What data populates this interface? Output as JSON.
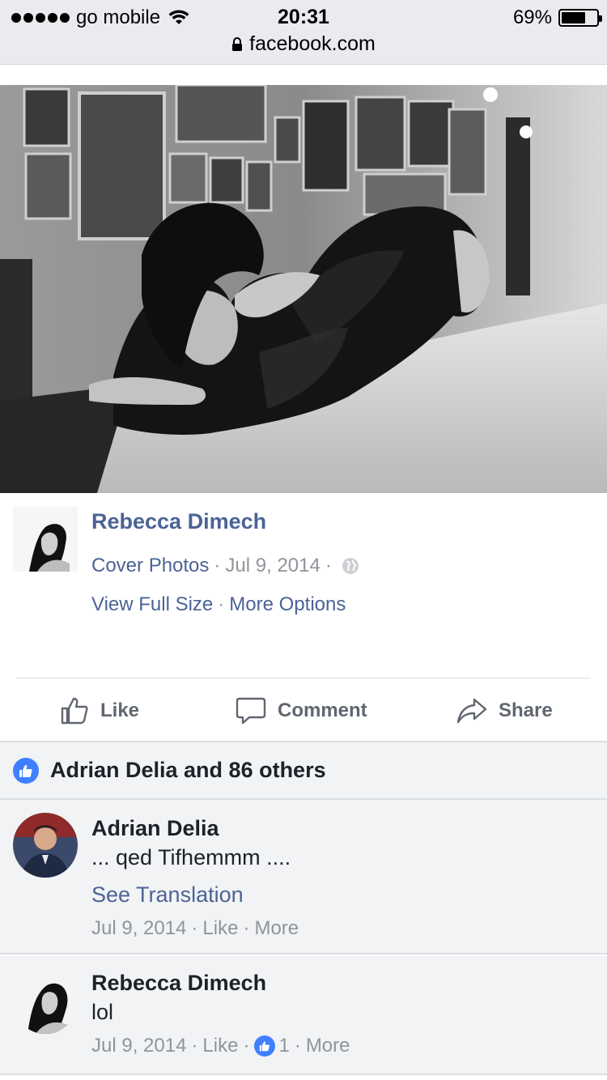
{
  "status_bar": {
    "carrier": "go mobile",
    "time": "20:31",
    "battery": "69%",
    "battery_level": 0.69,
    "url": "facebook.com"
  },
  "photo": {
    "description_icon": "cover-photo"
  },
  "post": {
    "owner_name": "Rebecca Dimech",
    "album": "Cover Photos",
    "date": "Jul 9, 2014",
    "privacy_icon": "globe-icon",
    "view_full_size": "View Full Size",
    "more_options": "More Options"
  },
  "actions": {
    "like": "Like",
    "comment": "Comment",
    "share": "Share"
  },
  "likes_summary": "Adrian Delia and 86 others",
  "comments": [
    {
      "author": "Adrian Delia",
      "text": "... qed Tifhemmm ....",
      "translate": "See Translation",
      "date": "Jul 9, 2014",
      "like": "Like",
      "more": "More"
    },
    {
      "author": "Rebecca Dimech",
      "text": "lol",
      "date": "Jul 9, 2014",
      "like": "Like",
      "like_count": "1",
      "more": "More"
    }
  ],
  "colors": {
    "link": "#4b6396",
    "accent": "#4080ff",
    "muted": "#90949c",
    "bg_gray": "#f2f3f5"
  }
}
